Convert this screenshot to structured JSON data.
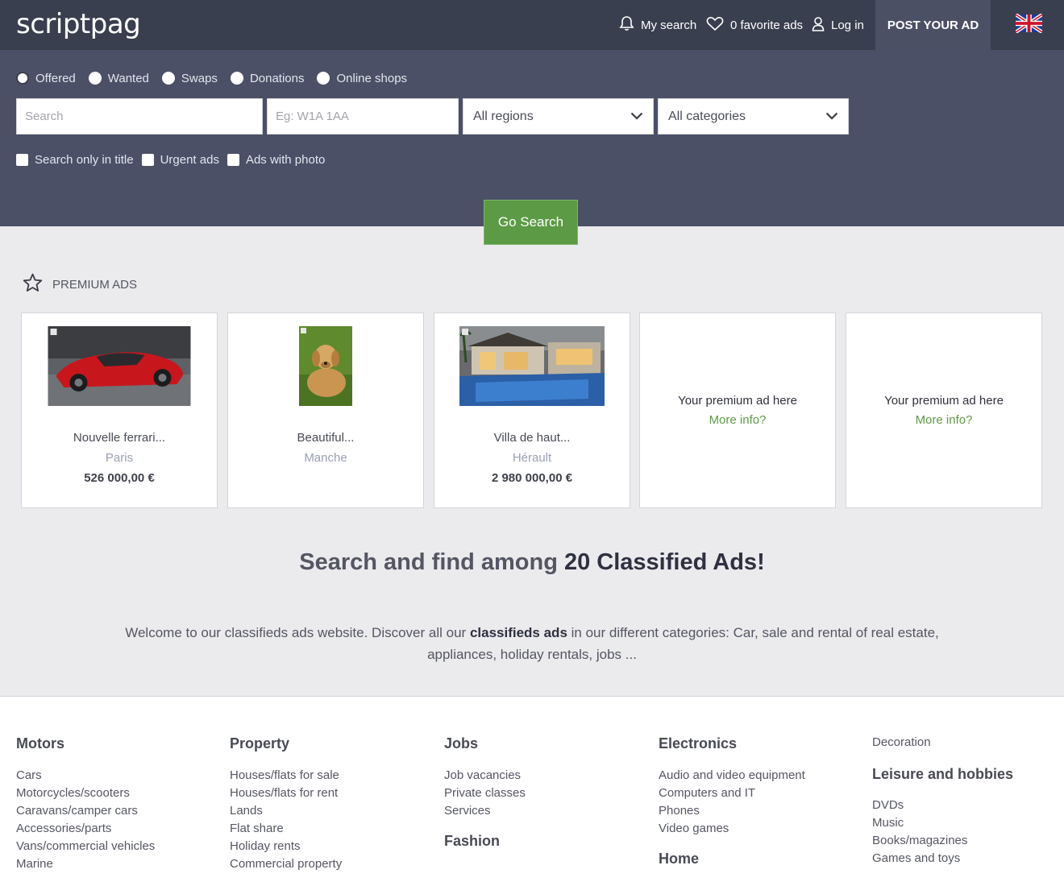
{
  "header": {
    "logo": "scriptpag",
    "my_search": "My search",
    "favorites": "0 favorite ads",
    "login": "Log in",
    "post_ad": "POST YOUR AD"
  },
  "search": {
    "radios": [
      "Offered",
      "Wanted",
      "Swaps",
      "Donations",
      "Online shops"
    ],
    "selected_radio": "Offered",
    "search_placeholder": "Search",
    "postcode_placeholder": "Eg: W1A 1AA",
    "region_value": "All regions",
    "category_value": "All categories",
    "checkboxes": [
      "Search only in title",
      "Urgent ads",
      "Ads with photo"
    ],
    "go_button": "Go Search"
  },
  "premium": {
    "heading": "PREMIUM ADS",
    "ads": [
      {
        "title": "Nouvelle ferrari...",
        "location": "Paris",
        "price": "526 000,00 €"
      },
      {
        "title": "Beautiful...",
        "location": "Manche",
        "price": ""
      },
      {
        "title": "Villa de haut...",
        "location": "Hérault",
        "price": "2 980 000,00 €"
      }
    ],
    "placeholder_text": "Your premium ad here",
    "more_info": "More info?"
  },
  "headline": {
    "prefix": "Search and find among ",
    "emphasis": "20 Classified Ads!"
  },
  "intro": {
    "part1": "Welcome to our classifieds ads website. Discover all our ",
    "bold": "classifieds ads",
    "part2": " in our different categories: Car, sale and rental of real estate, appliances, holiday rentals, jobs ..."
  },
  "footer": {
    "motors": {
      "title": "Motors",
      "items": [
        "Cars",
        "Motorcycles/scooters",
        "Caravans/camper cars",
        "Accessories/parts",
        "Vans/commercial vehicles",
        "Marine"
      ]
    },
    "property": {
      "title": "Property",
      "items": [
        "Houses/flats for sale",
        "Houses/flats for rent",
        "Lands",
        "Flat share",
        "Holiday rents",
        "Commercial property"
      ]
    },
    "jobs": {
      "title": "Jobs",
      "items": [
        "Job vacancies",
        "Private classes",
        "Services"
      ]
    },
    "fashion": {
      "title": "Fashion"
    },
    "electronics": {
      "title": "Electronics",
      "items": [
        "Audio and video equipment",
        "Computers and IT",
        "Phones",
        "Video games"
      ]
    },
    "home": {
      "title": "Home"
    },
    "decoration": {
      "title": "Decoration"
    },
    "leisure": {
      "title": "Leisure and hobbies",
      "items": [
        "DVDs",
        "Music",
        "Books/magazines",
        "Games and toys"
      ]
    }
  }
}
